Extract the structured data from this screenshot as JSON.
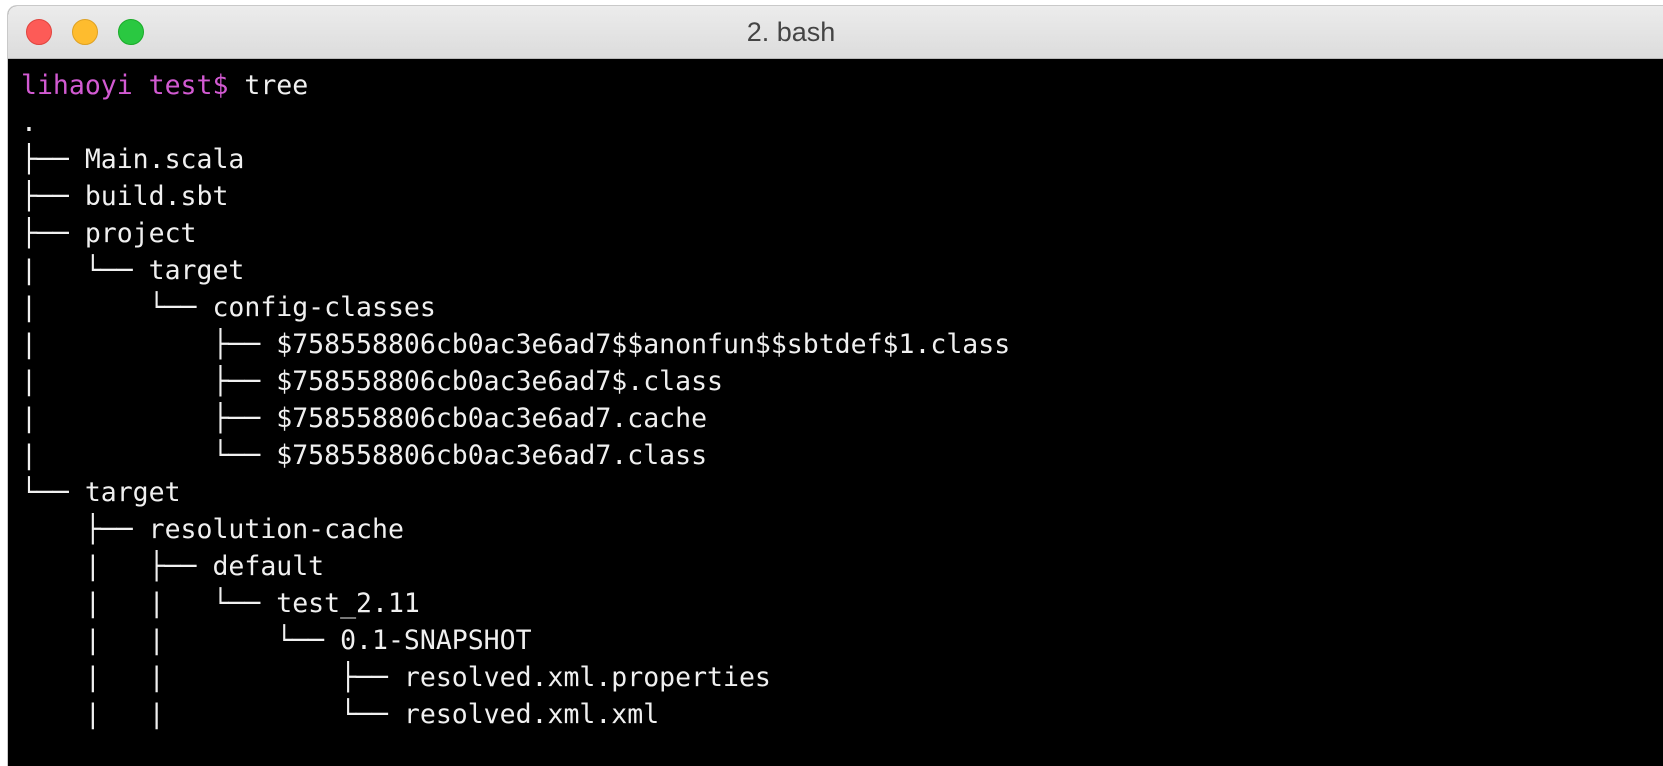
{
  "window": {
    "title": "2. bash"
  },
  "terminal": {
    "prompt": "lihaoyi test$ ",
    "command": "tree",
    "lines": [
      ".",
      "├── Main.scala",
      "├── build.sbt",
      "├── project",
      "|   └── target",
      "|       └── config-classes",
      "|           ├── $758558806cb0ac3e6ad7$$anonfun$$sbtdef$1.class",
      "|           ├── $758558806cb0ac3e6ad7$.class",
      "|           ├── $758558806cb0ac3e6ad7.cache",
      "|           └── $758558806cb0ac3e6ad7.class",
      "└── target",
      "    ├── resolution-cache",
      "    |   ├── default",
      "    |   |   └── test_2.11",
      "    |   |       └── 0.1-SNAPSHOT",
      "    |   |           ├── resolved.xml.properties",
      "    |   |           └── resolved.xml.xml"
    ]
  },
  "colors": {
    "prompt": "#d25ad2",
    "text": "#f0f0f0",
    "background": "#000000"
  }
}
